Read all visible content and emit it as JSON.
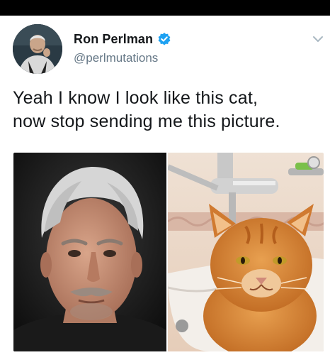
{
  "tweet": {
    "display_name": "Ron Perlman",
    "handle": "@perlmutations",
    "verified": true,
    "text_lines": [
      "Yeah I know I look like this cat,",
      "now stop sending me this picture."
    ]
  },
  "icons": {
    "verified": "verified-badge-icon",
    "more": "chevron-down-icon"
  },
  "colors": {
    "name": "#14171a",
    "handle": "#657786",
    "verified": "#1da1f2",
    "chevron": "#aab8c2"
  },
  "media": {
    "left_image": "photo of a man with grey hair and a mustache",
    "right_image": "photo of an orange cat sitting in a bathroom sink"
  }
}
